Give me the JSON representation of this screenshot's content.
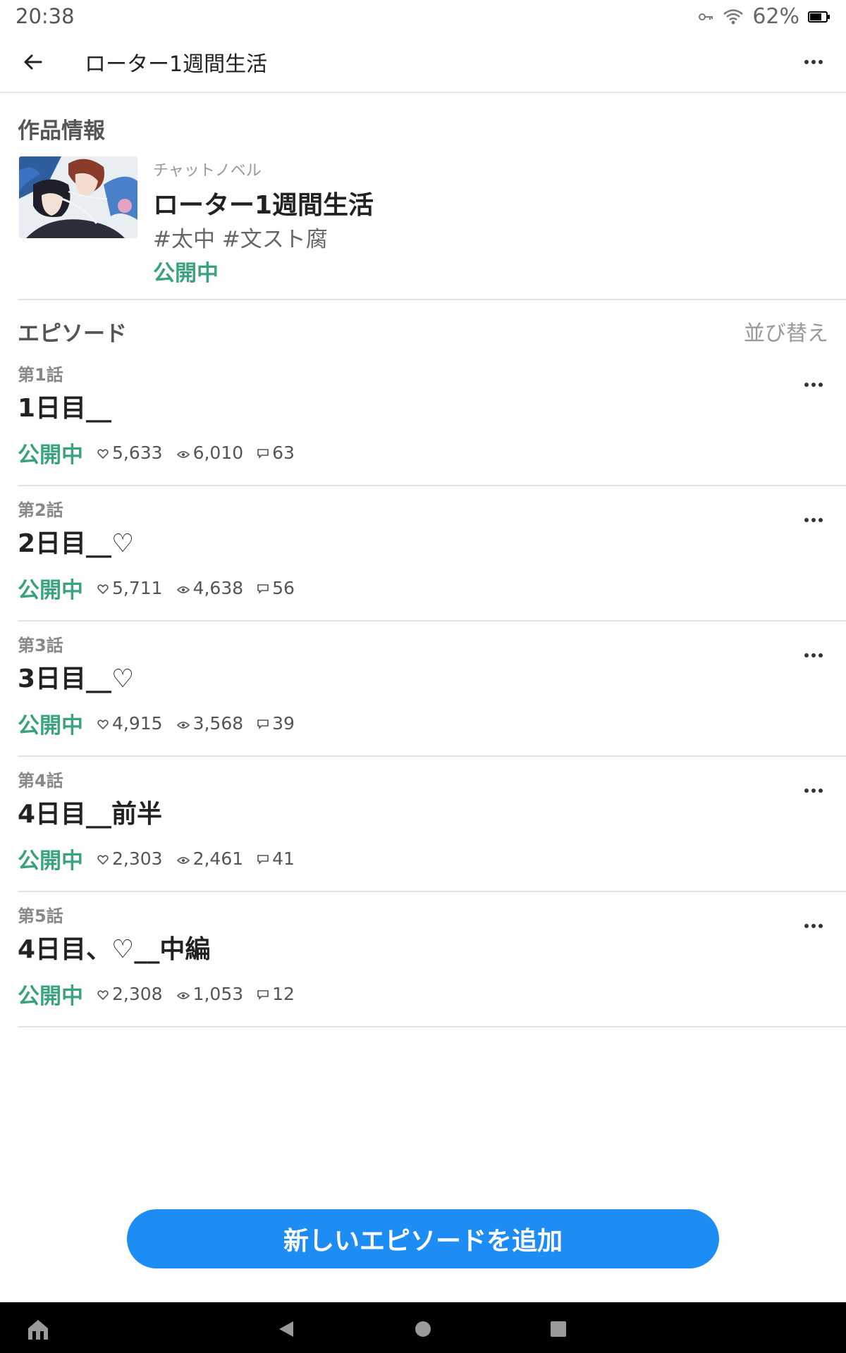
{
  "status_bar": {
    "time": "20:38",
    "battery": "62%",
    "icons": [
      "key-icon",
      "wifi-icon",
      "battery-icon"
    ]
  },
  "app_bar": {
    "title": "ローター1週間生活",
    "back_icon": "arrow-left-icon",
    "more_icon": "more-horizontal-icon"
  },
  "work_info": {
    "section_title": "作品情報",
    "category": "チャットノベル",
    "title": "ローター1週間生活",
    "tags": "#太中 #文スト腐",
    "status": "公開中"
  },
  "episodes_section": {
    "label": "エピソード",
    "sort_label": "並び替え"
  },
  "episodes": [
    {
      "number": "第1話",
      "title": "1日目__",
      "status": "公開中",
      "likes": "5,633",
      "views": "6,010",
      "comments": "63"
    },
    {
      "number": "第2話",
      "title": "2日目__♡",
      "status": "公開中",
      "likes": "5,711",
      "views": "4,638",
      "comments": "56"
    },
    {
      "number": "第3話",
      "title": "3日目__♡",
      "status": "公開中",
      "likes": "4,915",
      "views": "3,568",
      "comments": "39"
    },
    {
      "number": "第4話",
      "title": "4日目__前半",
      "status": "公開中",
      "likes": "2,303",
      "views": "2,461",
      "comments": "41"
    },
    {
      "number": "第5話",
      "title": "4日目、♡__中編",
      "status": "公開中",
      "likes": "2,308",
      "views": "1,053",
      "comments": "12"
    }
  ],
  "add_button": {
    "label": "新しいエピソードを追加"
  },
  "nav_bar": {
    "icons": [
      "home-icon",
      "back-triangle-icon",
      "home-circle-icon",
      "recents-square-icon"
    ]
  },
  "colors": {
    "accent_blue": "#1e8cf5",
    "status_green": "#3aa37b"
  }
}
